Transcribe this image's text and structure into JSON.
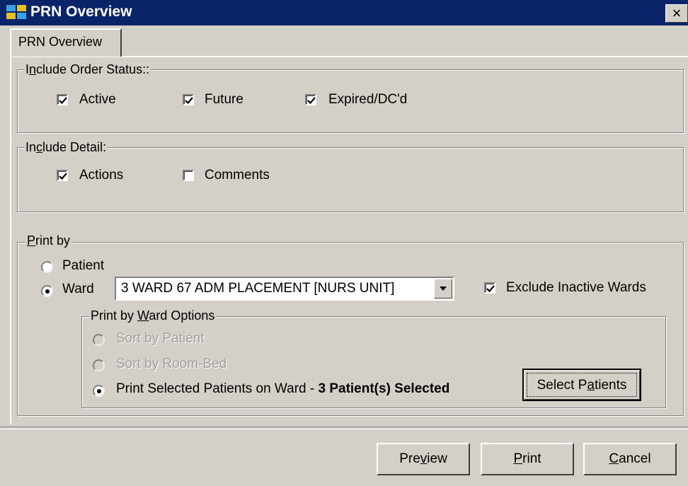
{
  "window": {
    "title": "PRN Overview",
    "close_glyph": "×",
    "app_icon": "vista-app-icon"
  },
  "tab": {
    "label": "PRN Overview"
  },
  "order_status": {
    "legend": {
      "pre": "I",
      "key": "n",
      "post": "clude Order Status::"
    },
    "items": [
      {
        "label": "Active",
        "checked": true
      },
      {
        "label": "Future",
        "checked": true
      },
      {
        "label": "Expired/DC'd",
        "checked": true
      }
    ]
  },
  "detail": {
    "legend": {
      "pre": "In",
      "key": "c",
      "post": "lude Detail:"
    },
    "items": [
      {
        "label": "Actions",
        "checked": true
      },
      {
        "label": "Comments",
        "checked": false
      }
    ]
  },
  "print_by": {
    "legend": {
      "pre": "",
      "key": "P",
      "post": "rint by"
    },
    "patient_label": "Patient",
    "ward_label": "Ward",
    "selected": "Ward",
    "ward_value": "3 WARD 67 ADM PLACEMENT [NURS UNIT]",
    "exclude_inactive": {
      "label": "Exclude Inactive Wards",
      "checked": true
    },
    "ward_options": {
      "legend": {
        "pre": "Print by ",
        "key": "W",
        "post": "ard Options"
      },
      "sort_patient": "Sort by Patient",
      "sort_room_bed": "Sort by Room-Bed",
      "print_selected": "Print Selected Patients on Ward - ",
      "selected_count": "3 Patient(s) Selected",
      "select_patients": {
        "pre": "Select P",
        "key": "a",
        "post": "tients"
      }
    }
  },
  "footer": {
    "preview": {
      "pre": "Pre",
      "key": "v",
      "post": "iew"
    },
    "print": {
      "pre": "",
      "key": "P",
      "post": "rint"
    },
    "cancel": {
      "pre": "",
      "key": "C",
      "post": "ancel"
    }
  }
}
